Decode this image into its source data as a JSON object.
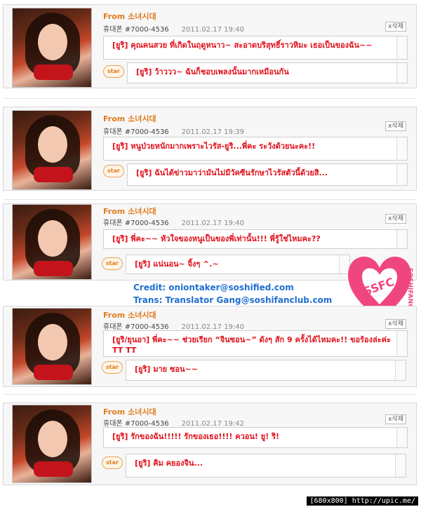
{
  "posts": [
    {
      "from": "From 소녀시대",
      "phone": "휴대폰 #7000-4536",
      "date": "2011.02.17 19:40",
      "delete": "x삭제",
      "message": "[ยูริ] คุณคนสวย ที่เกิดในฤดูหนาว~ สะอาดบริสุทธิ์ราวหิมะ เธอเป็นของฉัน~~",
      "star": "star",
      "reply": "[ยูริ] ว้าววว~ ฉันก็ชอบเพลงนั้นมากเหมือนกัน"
    },
    {
      "from": "From 소녀시대",
      "phone": "휴대폰 #7000-4536",
      "date": "2011.02.17 19:39",
      "delete": "x삭제",
      "message": "[ยูริ] หนูป่วยหนักมากเพราะไวรัส-ยูริ...พี่คะ ระวังด้วยนะคะ!!",
      "star": "star",
      "reply": "[ยูริ] ฉันได้ข่าวมาว่ามันไม่มีวัคซีนรักษาไวรัสตัวนี้ด้วยสิ..."
    },
    {
      "from": "From 소녀시대",
      "phone": "휴대폰 #7000-4536",
      "date": "2011.02.17 19:40",
      "delete": "x삭제",
      "message": "[ยูริ] พี่คะ~~ หัวใจของหนูเป็นของพี่เท่านั้น!!! พี่รู้ใช่ไหมคะ??",
      "star": "star",
      "reply": "[ยูริ] แน่นอน~ จิ้งๆ ^.~"
    },
    {
      "from": "From 소녀시대",
      "phone": "휴대폰 #7000-4536",
      "date": "2011.02.17 19:40",
      "delete": "x삭제",
      "message": "[ยูริ/ยุนอา] พี่คะ~~ ช่วยเรียก “จินซอน~” ดังๆ สัก 9 ครั้งได้ไหมคะ!! ขอร้องล่ะค่ะ TT TT",
      "star": "star",
      "reply": "[ยูริ] มาย ซอน~~"
    },
    {
      "from": "From 소녀시대",
      "phone": "휴대폰 #7000-4536",
      "date": "2011.02.17 19:42",
      "delete": "x삭제",
      "message": "[ยูริ] รักของฉัน!!!!! รักของเธอ!!!! ควอน! ยู! ริ!",
      "star": "star",
      "reply": "[ยูริ] คิม คยองจิน..."
    }
  ],
  "credits": {
    "credit": "Credit: oniontaker@soshified.com",
    "trans": "Trans: Translator Gang@soshifanclub.com"
  },
  "logo": {
    "text": "SSFC",
    "side": "SOSHIFANCLUB",
    "color": "#f0467f"
  },
  "footer": "[680x800] http://upic.me/"
}
